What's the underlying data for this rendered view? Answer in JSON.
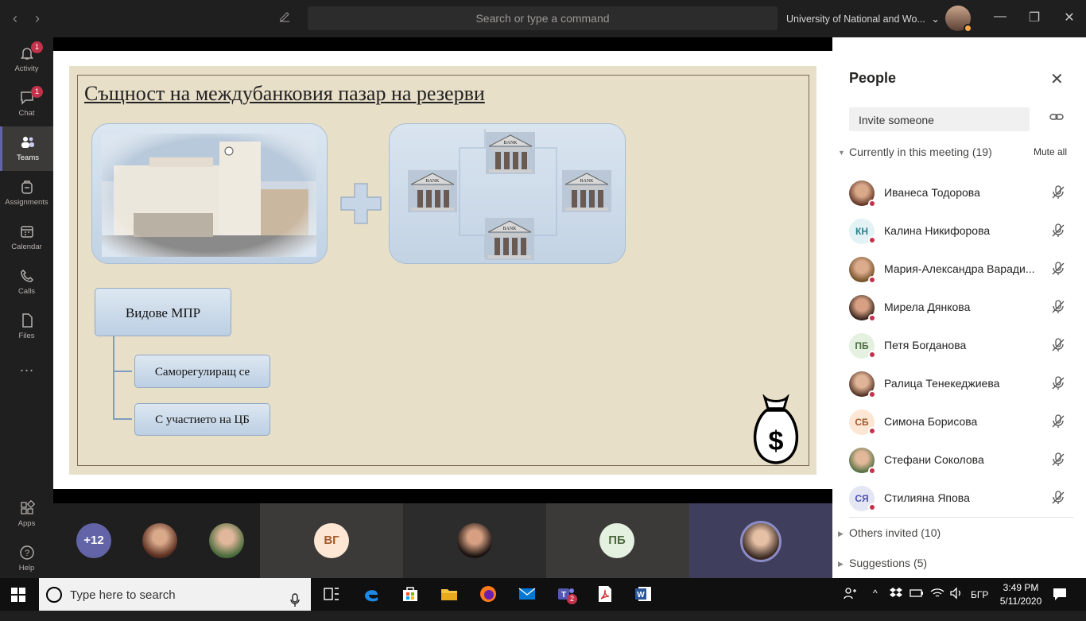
{
  "titlebar": {
    "search_placeholder": "Search or type a command",
    "org_name": "University of National and Wo...",
    "chevron": "⌄"
  },
  "rail": {
    "items": [
      {
        "label": "Activity",
        "badge": "1"
      },
      {
        "label": "Chat",
        "badge": "1"
      },
      {
        "label": "Teams"
      },
      {
        "label": "Assignments"
      },
      {
        "label": "Calendar"
      },
      {
        "label": "Calls"
      },
      {
        "label": "Files"
      },
      {
        "label": "Apps"
      },
      {
        "label": "Help"
      }
    ]
  },
  "slide": {
    "title": "Същност на междубанковия пазар на резерви",
    "bank_label": "BANK",
    "types_box": "Видове МПР",
    "option1": "Саморегулиращ се",
    "option2": "С участието на ЦБ",
    "money_symbol": "$"
  },
  "stage": {
    "overflow_count": "+12",
    "tiles": [
      {
        "initials": "ВГ"
      },
      {
        "initials": "ПБ"
      }
    ]
  },
  "people_panel": {
    "title": "People",
    "invite_placeholder": "Invite someone",
    "current_section": "Currently in this meeting (19)",
    "mute_all": "Mute all",
    "participants": [
      {
        "name": "Иванеса Тодорова",
        "initials": ""
      },
      {
        "name": "Калина Никифорова",
        "initials": "КН"
      },
      {
        "name": "Мария-Александра Варади...",
        "initials": ""
      },
      {
        "name": "Мирела Дянкова",
        "initials": ""
      },
      {
        "name": "Петя Богданова",
        "initials": "ПБ"
      },
      {
        "name": "Ралица Тенекеджиева",
        "initials": ""
      },
      {
        "name": "Симона Борисова",
        "initials": "СБ"
      },
      {
        "name": "Стефани Соколова",
        "initials": ""
      },
      {
        "name": "Стилияна Япова",
        "initials": "СЯ"
      }
    ],
    "others_invited": "Others invited (10)",
    "suggestions": "Suggestions (5)"
  },
  "taskbar": {
    "search_placeholder": "Type here to search",
    "teams_badge": "2",
    "language": "БГР",
    "time": "3:49 PM",
    "date": "5/11/2020"
  },
  "colors": {
    "accent": "#6264a7",
    "panel_bg": "#ffffff",
    "slide_bg": "#e8dfc9",
    "status_busy": "#c4314b"
  }
}
